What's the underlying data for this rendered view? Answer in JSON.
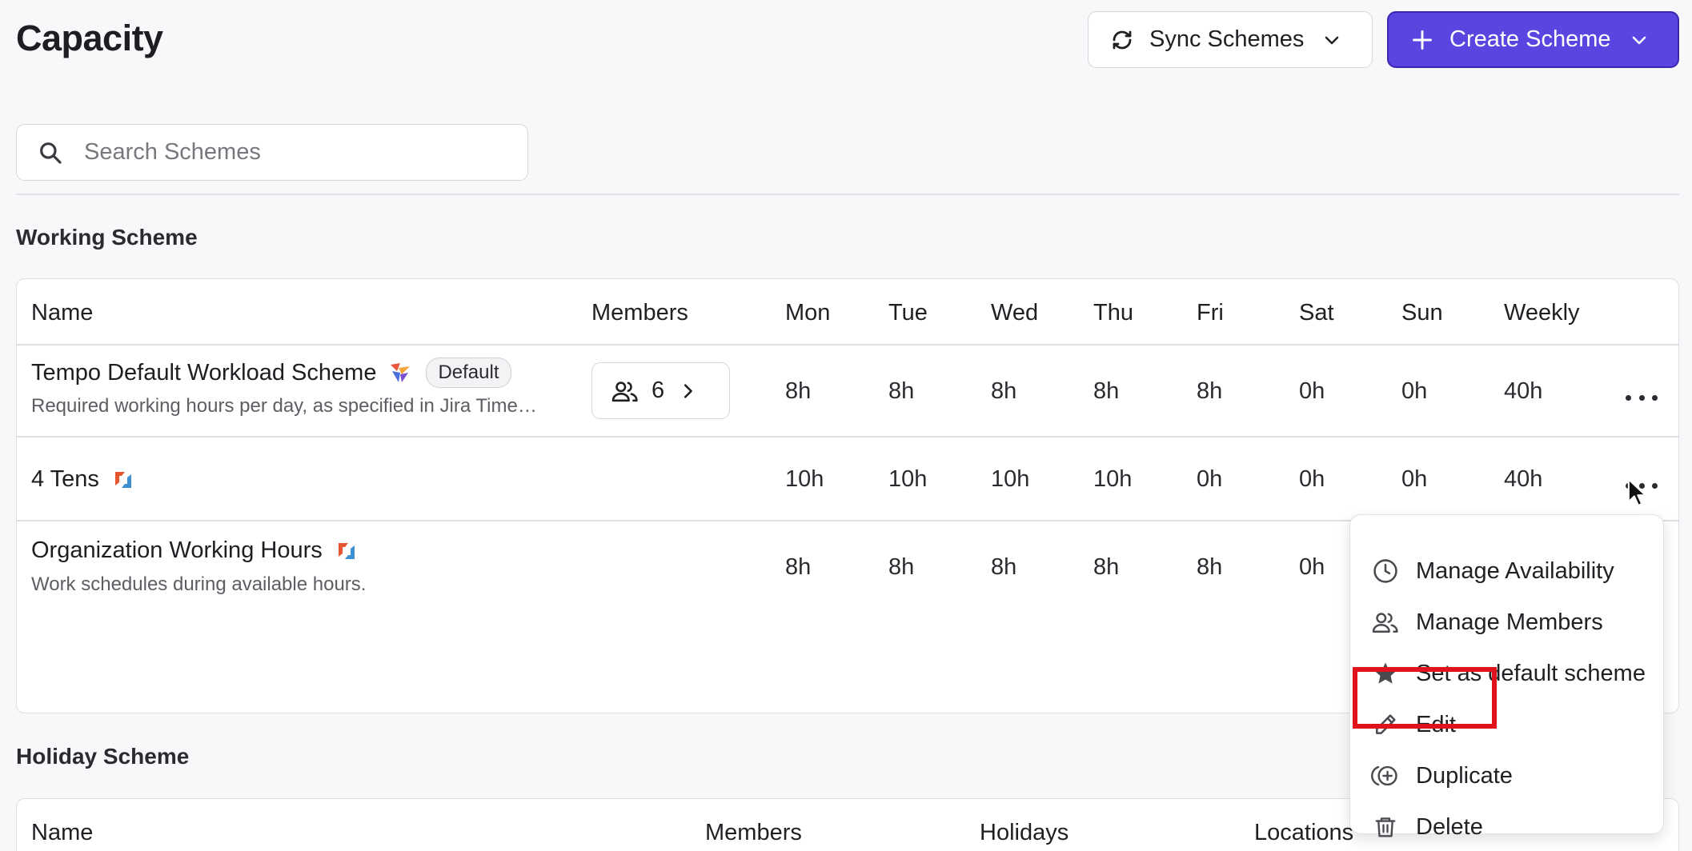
{
  "page": {
    "title": "Capacity"
  },
  "toolbar": {
    "sync_label": "Sync Schemes",
    "create_label": "Create Scheme",
    "accent_color": "#5b45e0"
  },
  "search": {
    "placeholder": "Search Schemes"
  },
  "working_scheme": {
    "title": "Working Scheme",
    "columns": [
      "Name",
      "Members",
      "Mon",
      "Tue",
      "Wed",
      "Thu",
      "Fri",
      "Sat",
      "Sun",
      "Weekly"
    ],
    "rows": [
      {
        "name": "Tempo Default Workload Scheme",
        "badge": "Default",
        "description": "Required working hours per day, as specified in Jira Time…",
        "members": "6",
        "days": [
          "8h",
          "8h",
          "8h",
          "8h",
          "8h",
          "0h",
          "0h"
        ],
        "weekly": "40h"
      },
      {
        "name": "4 Tens",
        "days": [
          "10h",
          "10h",
          "10h",
          "10h",
          "0h",
          "0h",
          "0h"
        ],
        "weekly": "40h"
      },
      {
        "name": "Organization Working Hours",
        "description": "Work schedules during available hours.",
        "days": [
          "8h",
          "8h",
          "8h",
          "8h",
          "8h",
          "0h"
        ]
      }
    ]
  },
  "holiday_scheme": {
    "title": "Holiday Scheme",
    "columns": [
      "Name",
      "Members",
      "Holidays",
      "Locations"
    ]
  },
  "context_menu": {
    "items": [
      {
        "label": "Manage Availability",
        "icon": "clock-icon"
      },
      {
        "label": "Manage Members",
        "icon": "users-icon"
      },
      {
        "label": "Set as default scheme",
        "icon": "star-icon"
      },
      {
        "label": "Edit",
        "icon": "pencil-icon"
      },
      {
        "label": "Duplicate",
        "icon": "duplicate-icon"
      },
      {
        "label": "Delete",
        "icon": "trash-icon"
      }
    ],
    "highlighted_item": "Edit",
    "highlight_color": "#e0121b"
  }
}
